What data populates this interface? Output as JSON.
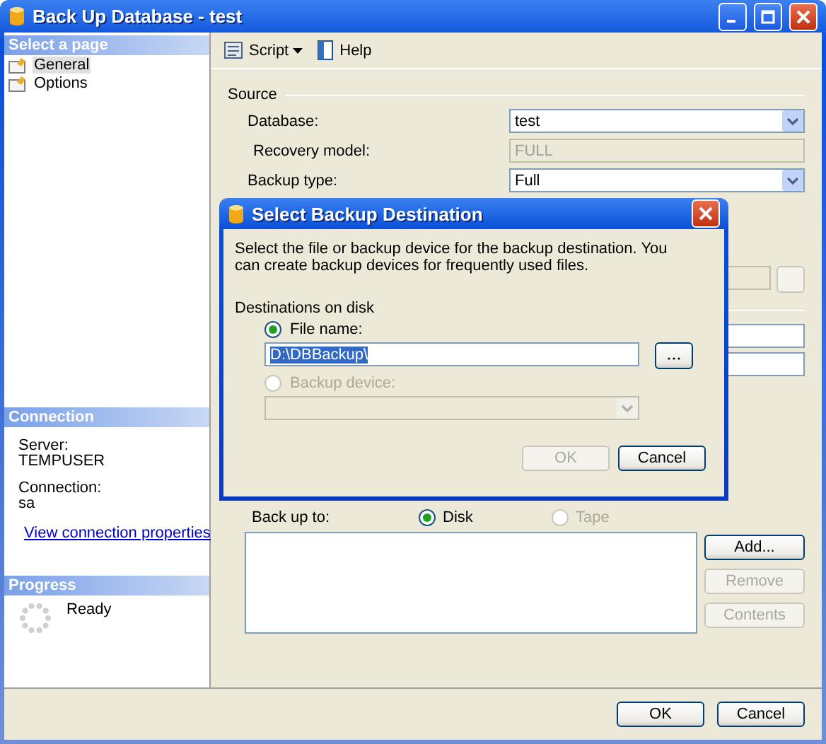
{
  "window": {
    "title": "Back Up Database - test"
  },
  "sidebar": {
    "pages_header": "Select a page",
    "pages": [
      {
        "label": "General",
        "selected": true
      },
      {
        "label": "Options",
        "selected": false
      }
    ],
    "connection": {
      "header": "Connection",
      "server_label": "Server:",
      "server": "TEMPUSER",
      "connection_label": "Connection:",
      "connection": "sa",
      "link": "View connection properties"
    },
    "progress": {
      "header": "Progress",
      "status": "Ready"
    }
  },
  "toolbar": [
    {
      "label": "Script",
      "kind": "menu"
    },
    {
      "label": "Help",
      "kind": "plain"
    }
  ],
  "source": {
    "title": "Source",
    "fields": [
      {
        "label": "Database:",
        "value": "test",
        "kind": "combo",
        "disabled": false
      },
      {
        "label": "Recovery model:",
        "value": "FULL",
        "kind": "text",
        "disabled": true
      },
      {
        "label": "Backup type:",
        "value": "Full",
        "kind": "combo",
        "disabled": false
      }
    ]
  },
  "destination": {
    "label": "Back up to:",
    "options": [
      {
        "label": "Disk",
        "selected": true,
        "disabled": false
      },
      {
        "label": "Tape",
        "selected": false,
        "disabled": true
      }
    ],
    "buttons": [
      {
        "label": "Add...",
        "disabled": false
      },
      {
        "label": "Remove",
        "disabled": true
      },
      {
        "label": "Contents",
        "disabled": true
      }
    ]
  },
  "footer_buttons": [
    {
      "label": "OK",
      "disabled": false
    },
    {
      "label": "Cancel",
      "disabled": false
    }
  ],
  "dialog": {
    "title": "Select Backup Destination",
    "description": "Select the file or backup device for the backup destination. You can create backup devices for frequently used files.",
    "section": "Destinations on disk",
    "options": [
      {
        "label": "File name:",
        "selected": true,
        "disabled": false
      },
      {
        "label": "Backup device:",
        "selected": false,
        "disabled": true
      }
    ],
    "file_value": "D:\\DBBackup\\",
    "buttons": [
      {
        "label": "OK",
        "disabled": true
      },
      {
        "label": "Cancel",
        "disabled": false
      }
    ]
  }
}
